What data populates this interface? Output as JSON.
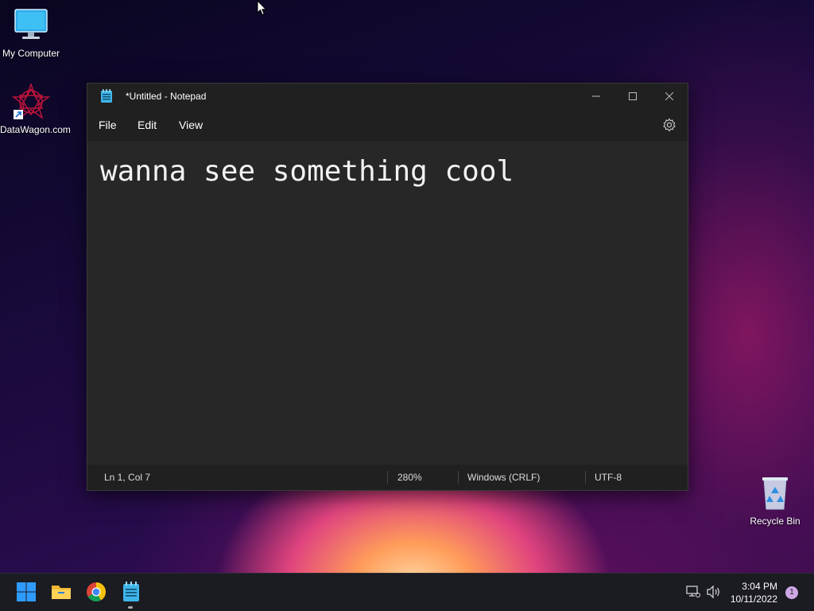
{
  "desktop": {
    "icons": [
      {
        "label": "My Computer"
      },
      {
        "label": "DataWagon.com"
      },
      {
        "label": "Recycle Bin"
      }
    ]
  },
  "window": {
    "title": "*Untitled - Notepad",
    "menu": {
      "file": "File",
      "edit": "Edit",
      "view": "View"
    },
    "content": "wanna see something cool",
    "status": {
      "position": "Ln 1, Col 7",
      "zoom": "280%",
      "line_ending": "Windows (CRLF)",
      "encoding": "UTF-8"
    }
  },
  "taskbar": {
    "apps": [
      "windows-start-icon",
      "file-explorer-icon",
      "chrome-icon",
      "notepad-icon"
    ],
    "clock": {
      "time": "3:04 PM",
      "date": "10/11/2022"
    },
    "notification_count": "1"
  },
  "colors": {
    "window_bg": "#272727",
    "titlebar_bg": "#202020",
    "taskbar_bg": "#1b1b22",
    "start_blue": "#2f9bff"
  }
}
